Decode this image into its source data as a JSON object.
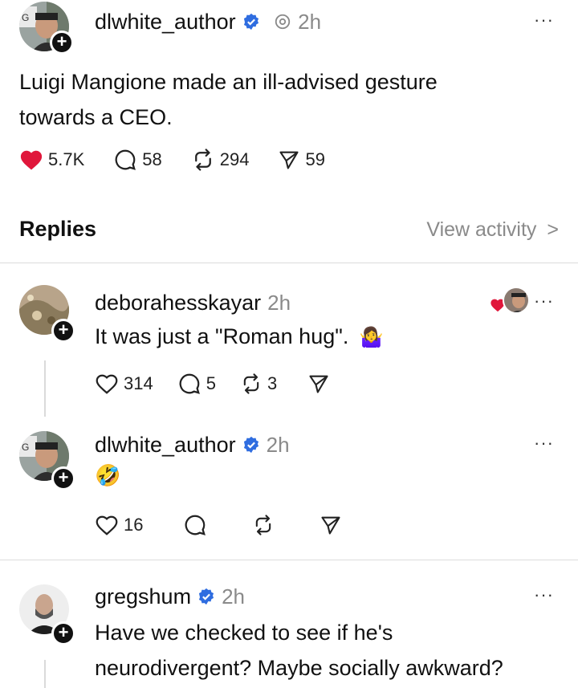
{
  "main_post": {
    "username": "dlwhite_author",
    "time": "2h",
    "text_line1": "Luigi Mangione made an ill-advised gesture",
    "text_line2": "towards a CEO.",
    "likes": "5.7K",
    "comments": "58",
    "reposts": "294",
    "shares": "59",
    "more": "···"
  },
  "replies_header": {
    "title": "Replies",
    "view_activity": "View activity",
    "chevron": ">"
  },
  "replies": [
    {
      "username": "deborahesskayar",
      "time": "2h",
      "text": "It was just a \"Roman hug\".",
      "emoji": "🤷‍♀️",
      "likes": "314",
      "comments": "5",
      "reposts": "3",
      "more": "···"
    },
    {
      "username": "dlwhite_author",
      "time": "2h",
      "emoji": "🤣",
      "likes": "16",
      "more": "···"
    },
    {
      "username": "gregshum",
      "time": "2h",
      "text_line1": "Have we checked to see if he's",
      "text_line2": "neurodivergent? Maybe socially awkward?",
      "more": "···"
    }
  ],
  "colors": {
    "heart_filled": "#e0173b",
    "verified": "#2f6de0",
    "muted": "#8a8a8a"
  }
}
